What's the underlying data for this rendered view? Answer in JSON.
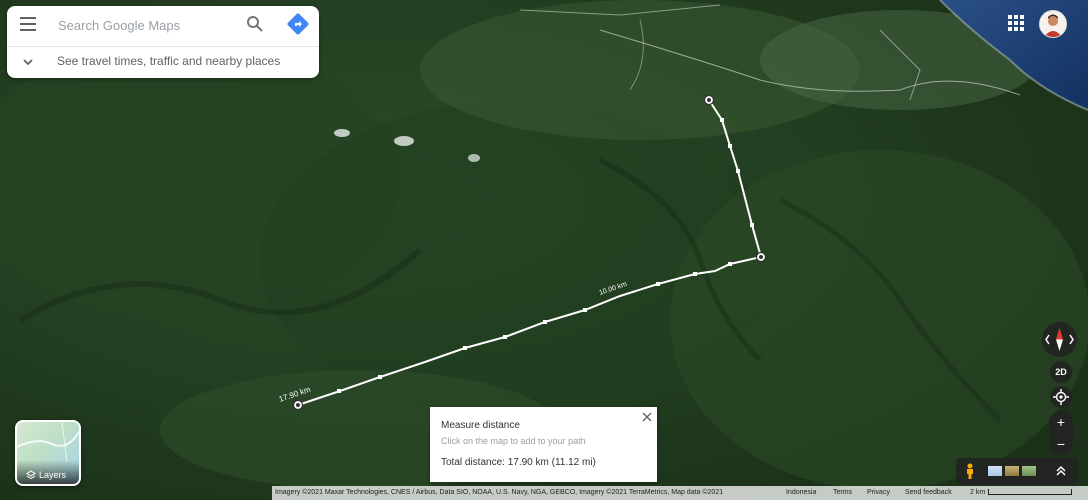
{
  "search": {
    "placeholder": "Search Google Maps"
  },
  "panel": {
    "expand_label": "See travel times, traffic and nearby places"
  },
  "measure": {
    "title": "Measure distance",
    "hint": "Click on the map to add to your path",
    "total": "Total distance: 17.90 km (11.12 mi)"
  },
  "path_labels": {
    "end": "17.90 km",
    "mid": "10.00 km"
  },
  "layers": {
    "label": "Layers"
  },
  "controls": {
    "view_mode": "2D",
    "zoom_in": "+",
    "zoom_out": "−"
  },
  "attribution": {
    "imagery": "Imagery ©2021 Maxar Technologies, CNES / Airbus, Data SIO, NOAA, U.S. Navy, NGA, GEBCO, Imagery ©2021 TerraMetrics, Map data ©2021",
    "country": "Indonesia",
    "terms": "Terms",
    "privacy": "Privacy",
    "feedback": "Send feedback",
    "scale": "2 km"
  },
  "colors": {
    "accent_blue": "#4285f4",
    "path": "#ffffff"
  },
  "icons": [
    "menu-icon",
    "search-icon",
    "directions-icon",
    "chevron-down-icon",
    "apps-icon",
    "avatar",
    "layers-icon",
    "close-icon",
    "compass-icon",
    "my-location-icon",
    "pegman-icon",
    "chevron-up-icon"
  ]
}
